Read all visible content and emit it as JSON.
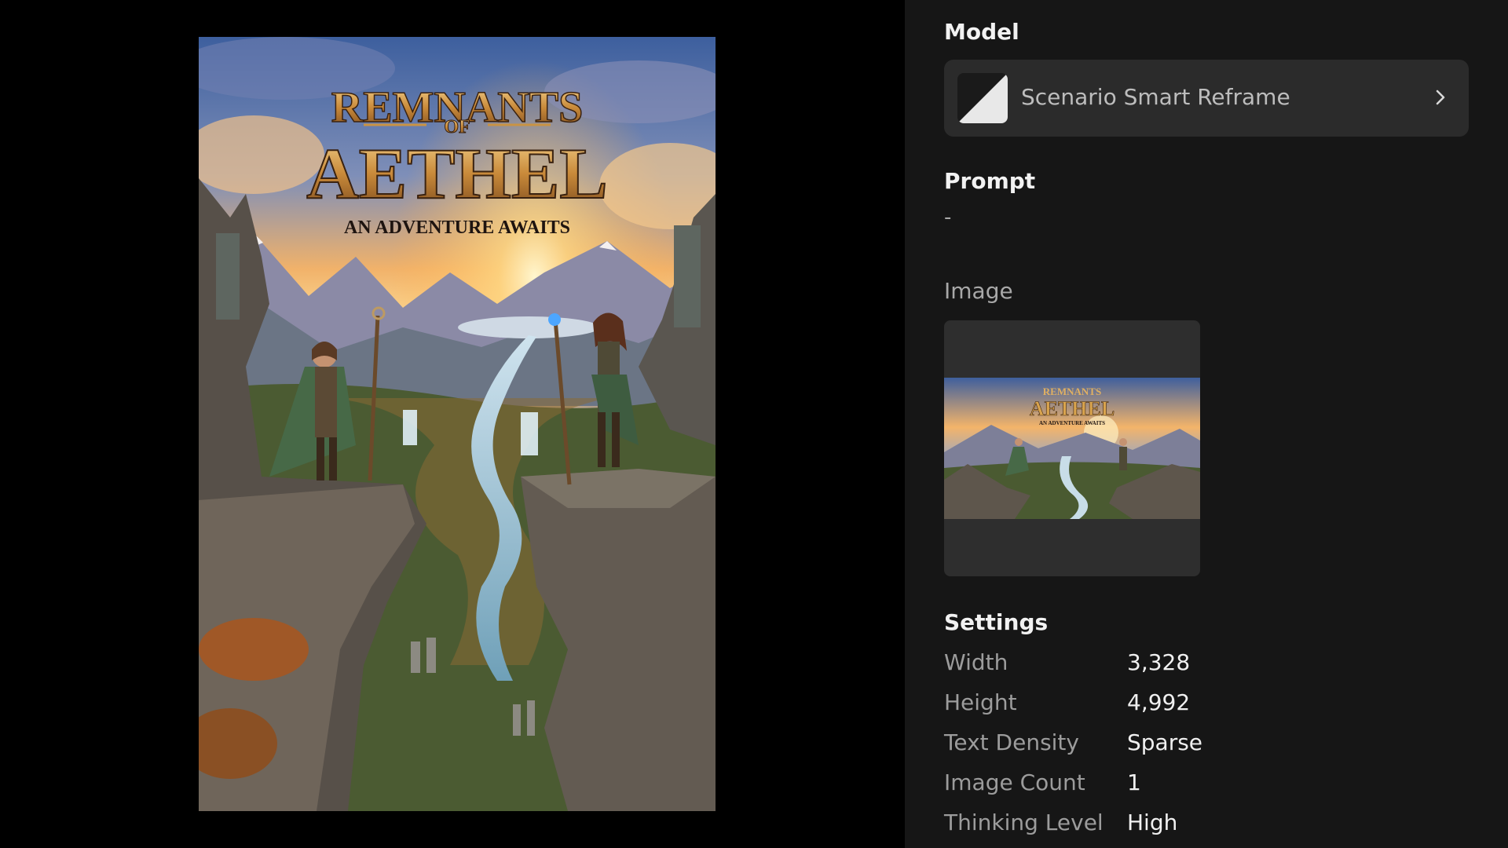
{
  "poster": {
    "title_line1": "REMNANTS",
    "title_of": "OF",
    "title_line2": "AETHEL",
    "tagline": "AN ADVENTURE AWAITS"
  },
  "thumbnail": {
    "title_line1": "REMNANTS",
    "title_line2": "AETHEL",
    "tagline": "AN ADVENTURE AWAITS"
  },
  "model": {
    "heading": "Model",
    "name": "Scenario Smart Reframe",
    "icon": "chevron-right-icon"
  },
  "prompt": {
    "heading": "Prompt",
    "value": "-"
  },
  "image": {
    "heading": "Image"
  },
  "settings": {
    "heading": "Settings",
    "rows": [
      {
        "label": "Width",
        "value": "3,328"
      },
      {
        "label": "Height",
        "value": "4,992"
      },
      {
        "label": "Text Density",
        "value": "Sparse"
      },
      {
        "label": "Image Count",
        "value": "1"
      },
      {
        "label": "Thinking Level",
        "value": "High"
      }
    ]
  },
  "colors": {
    "panel_bg": "#161616",
    "card_bg": "#2b2b2b",
    "title_gold": "#d9a44e"
  }
}
